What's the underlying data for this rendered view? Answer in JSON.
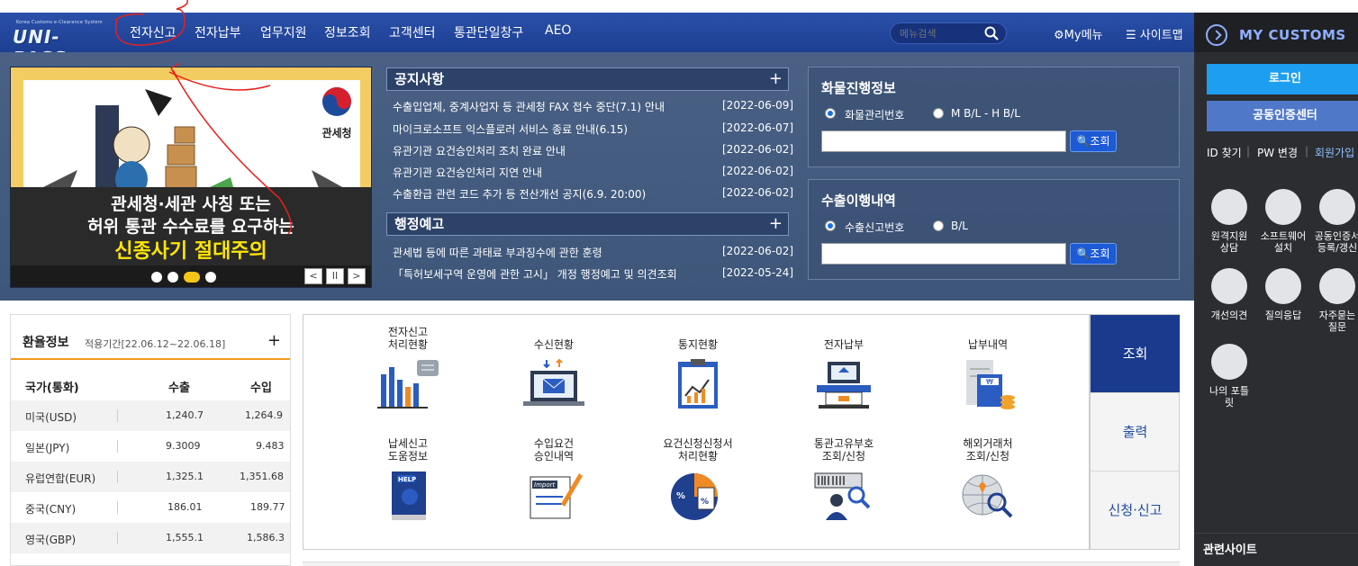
{
  "logo": {
    "small": "Korea Customs e-Clearance System",
    "big": "UNI-PASS"
  },
  "nav": {
    "items": [
      "전자신고",
      "전자납부",
      "업무지원",
      "정보조회",
      "고객센터",
      "통관단일창구",
      "AEO"
    ],
    "search_placeholder": "메뉴검색",
    "mymenu": "My메뉴",
    "sitemap": "사이트맵"
  },
  "banner": {
    "line1": "관세청·세관 사칭 또는",
    "line2": "허위 통관 수수료를 요구하는",
    "line3": "신종사기 절대주의",
    "seal_label": "관세청",
    "controls": {
      "prev": "<",
      "pause": "II",
      "next": ">"
    }
  },
  "notices": {
    "title": "공지사항",
    "plus": "+",
    "items": [
      {
        "text": "수출입업체, 중계사업자 등 관세청 FAX 접수 중단(7.1) 안내",
        "date": "[2022-06-09]"
      },
      {
        "text": "마이크로소프트 익스플로러 서비스 종료 안내(6.15)",
        "date": "[2022-06-07]"
      },
      {
        "text": "유관기관 요건승인처리 조치 완료 안내",
        "date": "[2022-06-02]"
      },
      {
        "text": "유관기관 요건승인처리 지연 안내",
        "date": "[2022-06-02]"
      },
      {
        "text": "수출환급 관련 코드 추가 등 전산개선 공지(6.9. 20:00)",
        "date": "[2022-06-02]"
      }
    ]
  },
  "admin_notice": {
    "title": "행정예고",
    "plus": "+",
    "items": [
      {
        "text": "관세법 등에 따른 과태료 부과징수에 관한 훈령",
        "date": "[2022-06-02]"
      },
      {
        "text": "「특허보세구역 운영에 관한 고시」 개정 행정예고 및 의견조회",
        "date": "[2022-05-24]"
      }
    ]
  },
  "cargo": {
    "title": "화물진행정보",
    "option1": "화물관리번호",
    "option2": "M B/L - H B/L",
    "button": "조회"
  },
  "export_history": {
    "title": "수출이행내역",
    "option1": "수출신고번호",
    "option2": "B/L",
    "button": "조회"
  },
  "fx": {
    "title": "환율정보",
    "period": "적용기간[22.06.12~22.06.18]",
    "plus": "+",
    "headers": {
      "country": "국가(통화)",
      "export": "수출",
      "import": "수입"
    },
    "rows": [
      {
        "country": "미국(USD)",
        "export": "1,240.7",
        "import": "1,264.9"
      },
      {
        "country": "일본(JPY)",
        "export": "9.3009",
        "import": "9.483"
      },
      {
        "country": "유럽연합(EUR)",
        "export": "1,325.1",
        "import": "1,351.68"
      },
      {
        "country": "중국(CNY)",
        "export": "186.01",
        "import": "189.77"
      },
      {
        "country": "영국(GBP)",
        "export": "1,555.1",
        "import": "1,586.3"
      }
    ]
  },
  "services": {
    "row1": [
      {
        "label": "전자신고\n처리현황",
        "icon": "bar-chart-icon"
      },
      {
        "label": "수신현황",
        "icon": "laptop-mail-icon"
      },
      {
        "label": "통지현황",
        "icon": "clipboard-chart-icon"
      },
      {
        "label": "전자납부",
        "icon": "payment-terminal-icon"
      },
      {
        "label": "납부내역",
        "icon": "receipt-icon"
      }
    ],
    "row2": [
      {
        "label": "납세신고\n도움정보",
        "icon": "help-book-icon"
      },
      {
        "label": "수입요건\n승인내역",
        "icon": "import-document-icon"
      },
      {
        "label": "요건신청신청서\n처리현황",
        "icon": "percent-document-icon"
      },
      {
        "label": "통관고유부호\n조회/신청",
        "icon": "barcode-search-icon"
      },
      {
        "label": "해외거래처\n조회/신청",
        "icon": "globe-search-icon"
      }
    ],
    "tabs": [
      "조회",
      "출력",
      "신청·신고"
    ]
  },
  "sidebar": {
    "title": "MY CUSTOMS",
    "login": "로그인",
    "cert_center": "공동인증센터",
    "links": [
      "ID 찾기",
      "PW 변경",
      "회원가입"
    ],
    "icons": [
      {
        "label": "원격지원\n상담",
        "icon": "remote-support-icon"
      },
      {
        "label": "소프트웨어\n설치",
        "icon": "software-install-icon"
      },
      {
        "label": "공동인증서\n등록/갱신",
        "icon": "certificate-icon"
      },
      {
        "label": "개선의견",
        "icon": "feedback-icon"
      },
      {
        "label": "질의응답",
        "icon": "qna-icon"
      },
      {
        "label": "자주묻는\n질문",
        "icon": "faq-icon"
      },
      {
        "label": "나의 포틀\n릿",
        "icon": "portlet-icon"
      }
    ],
    "related": "관련사이트"
  },
  "colors": {
    "nav_bg": "#1d3f93",
    "hero_bg": "#445d80",
    "accent_orange": "#f29a1d",
    "sidebar_bg": "#2b2d31",
    "login_btn": "#1e9ef0",
    "tab_active": "#1a3a8d"
  }
}
